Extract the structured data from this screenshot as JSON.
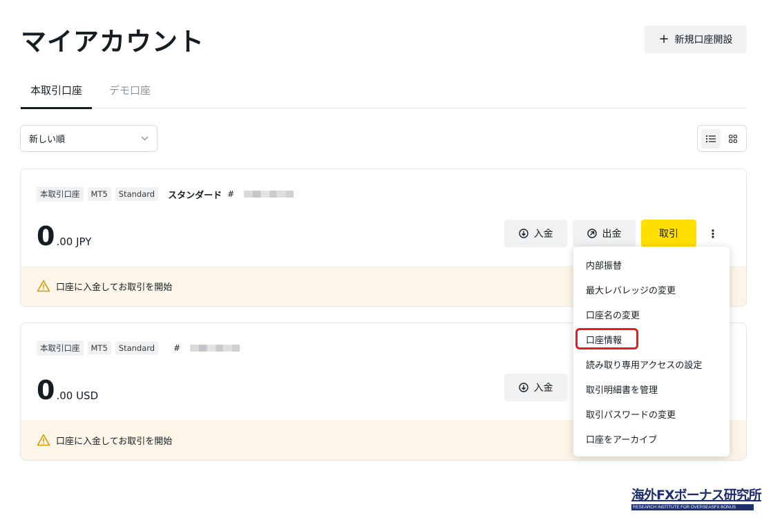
{
  "header": {
    "title": "マイアカウント",
    "new_account_label": "新規口座開設"
  },
  "tabs": [
    {
      "label": "本取引口座",
      "active": true
    },
    {
      "label": "デモ口座",
      "active": false
    }
  ],
  "sort": {
    "selected": "新しい順"
  },
  "view_modes": [
    "list",
    "grid"
  ],
  "accounts": [
    {
      "tags": [
        "本取引口座",
        "MT5",
        "Standard"
      ],
      "name": "スタンダード",
      "hash": "#",
      "balance_int": "0",
      "balance_rest": ".00 JPY",
      "warning": "口座に入金してお取引を開始"
    },
    {
      "tags": [
        "本取引口座",
        "MT5",
        "Standard"
      ],
      "name": "",
      "hash": "#",
      "balance_int": "0",
      "balance_rest": ".00 USD",
      "warning": "口座に入金してお取引を開始"
    }
  ],
  "actions": {
    "deposit": "入金",
    "withdraw": "出金",
    "trade": "取引",
    "more": "⋮"
  },
  "menu": {
    "items": [
      "内部振替",
      "最大レバレッジの変更",
      "口座名の変更",
      "口座情報",
      "読み取り専用アクセスの設定",
      "取引明細書を管理",
      "取引パスワードの変更",
      "口座をアーカイブ"
    ],
    "highlighted_index": 3
  },
  "watermark": {
    "main": "海外FXボーナス研究所",
    "sub": "RESEARCH INSTITUTE FOR OVERSEASFX BONUS"
  },
  "colors": {
    "accent": "#ffde02",
    "warning_bg": "#fdf5e8",
    "highlight": "#e51c1c"
  }
}
